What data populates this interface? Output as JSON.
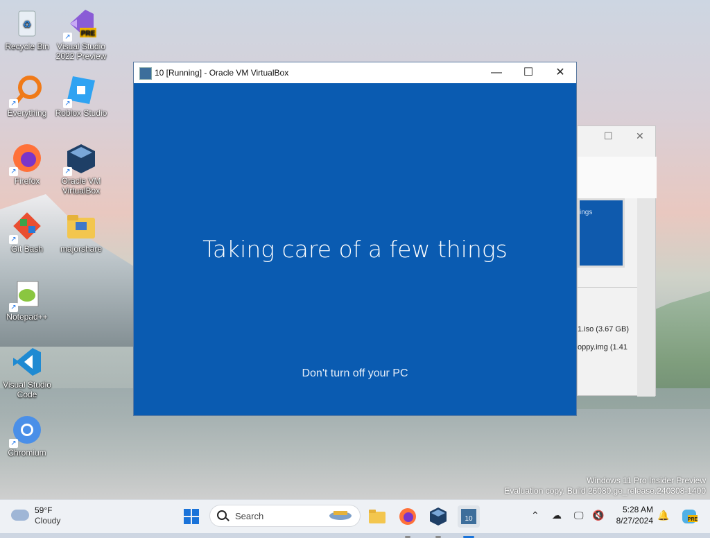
{
  "desktop": {
    "icons": [
      {
        "label": "Recycle Bin",
        "icon": "recycle-bin-icon"
      },
      {
        "label": "Visual Studio 2022 Preview",
        "icon": "visual-studio-preview-icon",
        "badge": "PRE"
      },
      {
        "label": "Everything",
        "icon": "everything-search-icon"
      },
      {
        "label": "Roblox Studio",
        "icon": "roblox-studio-icon"
      },
      {
        "label": "Firefox",
        "icon": "firefox-icon"
      },
      {
        "label": "Oracle VM VirtualBox",
        "icon": "virtualbox-icon"
      },
      {
        "label": "Git Bash",
        "icon": "git-bash-icon"
      },
      {
        "label": "majorshare",
        "icon": "folder-icon"
      },
      {
        "label": "Notepad++",
        "icon": "notepad-plus-plus-icon"
      },
      {
        "label": "Visual Studio Code",
        "icon": "vscode-icon"
      },
      {
        "label": "Chromium",
        "icon": "chromium-icon"
      }
    ]
  },
  "background_window": {
    "preview_text": "ings",
    "line1": "1.iso (3.67 GB)",
    "line2": "oppy.img (1.41"
  },
  "vm_window": {
    "title": "10 [Running] - Oracle VM VirtualBox",
    "heading": "Taking care of a few things",
    "subtext": "Don't turn off your PC",
    "bg_color": "#0a5bb1"
  },
  "watermark": {
    "line1": "Windows 11 Pro Insider Preview",
    "line2": "Evaluation copy. Build 26080.ge_release.240308-1400"
  },
  "taskbar": {
    "weather_temp": "59°F",
    "weather_cond": "Cloudy",
    "search_placeholder": "Search",
    "time": "5:28 AM",
    "date": "8/27/2024"
  }
}
